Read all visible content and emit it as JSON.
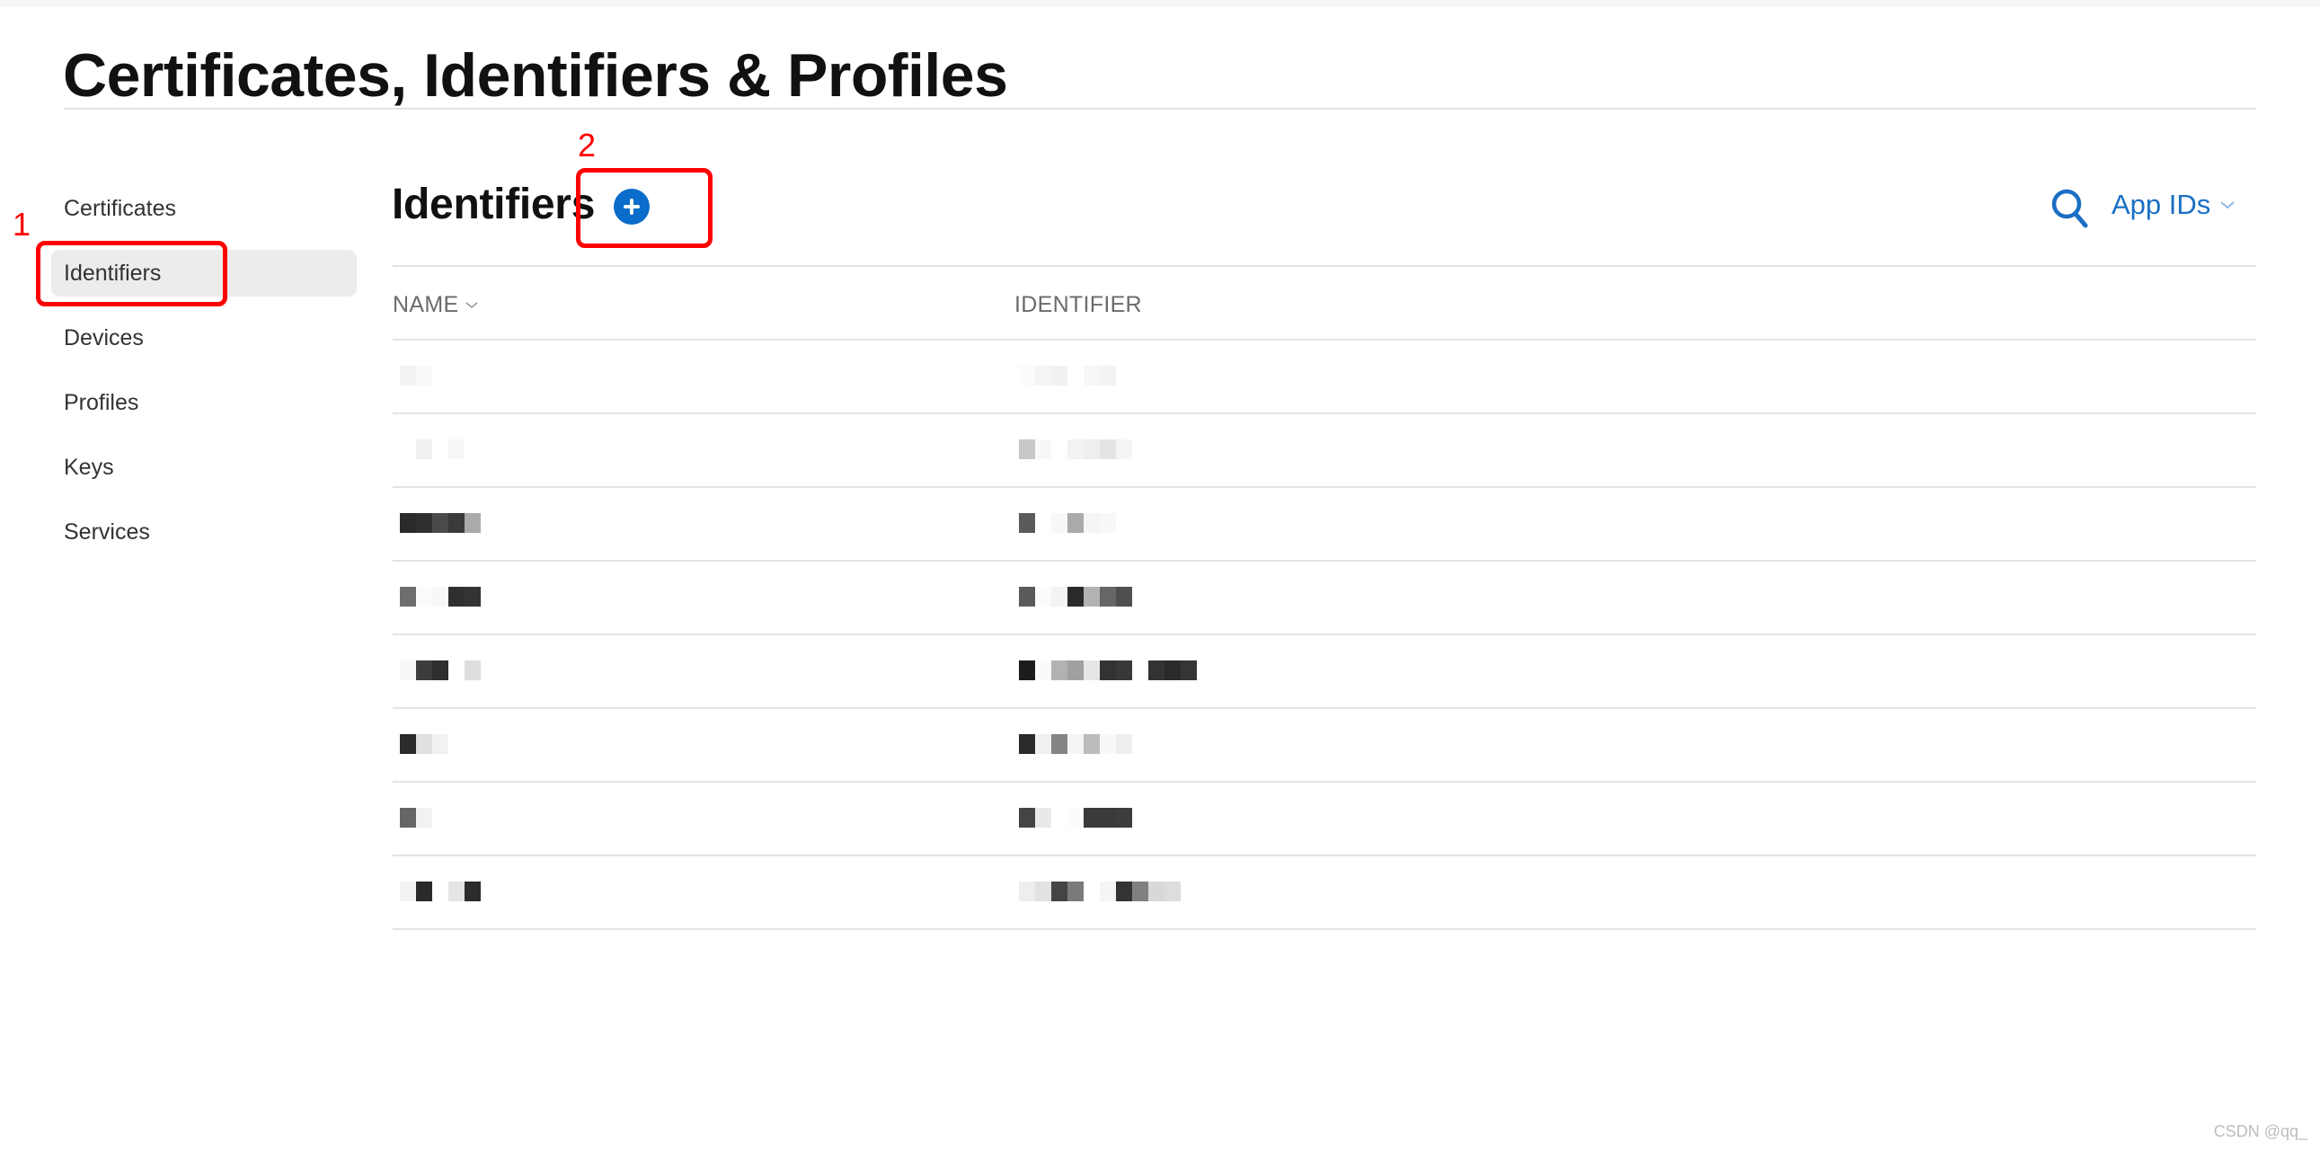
{
  "page": {
    "title": "Certificates, Identifiers & Profiles"
  },
  "sidebar": {
    "items": [
      {
        "label": "Certificates",
        "active": false
      },
      {
        "label": "Identifiers",
        "active": true
      },
      {
        "label": "Devices",
        "active": false
      },
      {
        "label": "Profiles",
        "active": false
      },
      {
        "label": "Keys",
        "active": false
      },
      {
        "label": "Services",
        "active": false
      }
    ]
  },
  "content": {
    "section_title": "Identifiers",
    "add_button_icon": "plus-circle-icon",
    "search_icon": "search-icon",
    "filter": {
      "selected": "App IDs",
      "icon": "chevron-down-icon"
    }
  },
  "table": {
    "columns": [
      {
        "label": "NAME",
        "sortable": true,
        "sort_icon": "chevron-down-icon"
      },
      {
        "label": "IDENTIFIER",
        "sortable": false
      }
    ],
    "rows_redacted": true,
    "rows": [
      {
        "name_mosaic": [
          "#f2f2f2",
          "#fafafa",
          "#ffffff"
        ],
        "identifier_mosaic": [
          "#fbfbfb",
          "#f5f5f5",
          "#f0f0f0",
          "#ffffff",
          "#f7f7f7",
          "#f3f3f3"
        ]
      },
      {
        "name_mosaic": [
          "#ffffff",
          "#f0f0f0",
          "#ffffff",
          "#f7f7f7"
        ],
        "identifier_mosaic": [
          "#c8c8c8",
          "#f8f8f8",
          "#ffffff",
          "#f3f3f3",
          "#eeeeee",
          "#e4e4e4",
          "#f5f5f5"
        ]
      },
      {
        "name_mosaic": [
          "#2a2a2a",
          "#2f2f2f",
          "#4a4a4a",
          "#3a3a3a",
          "#aaaaaa"
        ],
        "identifier_mosaic": [
          "#5a5a5a",
          "#ffffff",
          "#f7f7f7",
          "#aaaaaa",
          "#f5f5f5",
          "#f8f8f8"
        ]
      },
      {
        "name_mosaic": [
          "#6e6e6e",
          "#fbfbfb",
          "#f8f8f8",
          "#2f2f2f",
          "#333333"
        ],
        "identifier_mosaic": [
          "#5a5a5a",
          "#fbfbfb",
          "#f3f3f3",
          "#2a2a2a",
          "#b3b3b3",
          "#666666",
          "#4f4f4f"
        ]
      },
      {
        "name_mosaic": [
          "#f7f7f7",
          "#3c3c3c",
          "#2f2f2f",
          "#ffffff",
          "#dddddd"
        ],
        "identifier_mosaic": [
          "#1c1c1c",
          "#fafafa",
          "#b2b2b2",
          "#a0a0a0",
          "#e6e6e6",
          "#333333",
          "#383838",
          "#ffffff",
          "#333333",
          "#2a2a2a",
          "#353535"
        ]
      },
      {
        "name_mosaic": [
          "#2b2b2b",
          "#e0e0e0",
          "#f2f2f2"
        ],
        "identifier_mosaic": [
          "#2a2a2a",
          "#f0f0f0",
          "#848484",
          "#f5f5f5",
          "#bbbbbb",
          "#f8f8f8",
          "#eeeeee"
        ]
      },
      {
        "name_mosaic": [
          "#666666",
          "#f2f2f2"
        ],
        "identifier_mosaic": [
          "#444444",
          "#e9e9e9",
          "#ffffff",
          "#fcfcfc",
          "#3a3a3a",
          "#3a3a3a",
          "#3c3c3c"
        ]
      },
      {
        "name_mosaic": [
          "#f2f2f2",
          "#2a2a2a",
          "#ffffff",
          "#e4e4e4",
          "#2c2c2c"
        ],
        "identifier_mosaic": [
          "#eeeeee",
          "#e2e2e2",
          "#444444",
          "#7a7a7a",
          "#ffffff",
          "#f5f5f5",
          "#333333",
          "#808080",
          "#d8d8d8",
          "#dddddd"
        ]
      }
    ]
  },
  "annotations": [
    {
      "number": "1",
      "target": "sidebar-item-identifiers",
      "color": "#ff0000"
    },
    {
      "number": "2",
      "target": "add-identifier-button",
      "color": "#ff0000"
    }
  ],
  "watermark": "CSDN @qq_",
  "colors": {
    "accent_blue": "#0a6ccb",
    "link_blue": "#1a6fc4",
    "annotation_red": "#ff0000",
    "active_bg": "#ececec",
    "divider": "#e3e3e3"
  }
}
